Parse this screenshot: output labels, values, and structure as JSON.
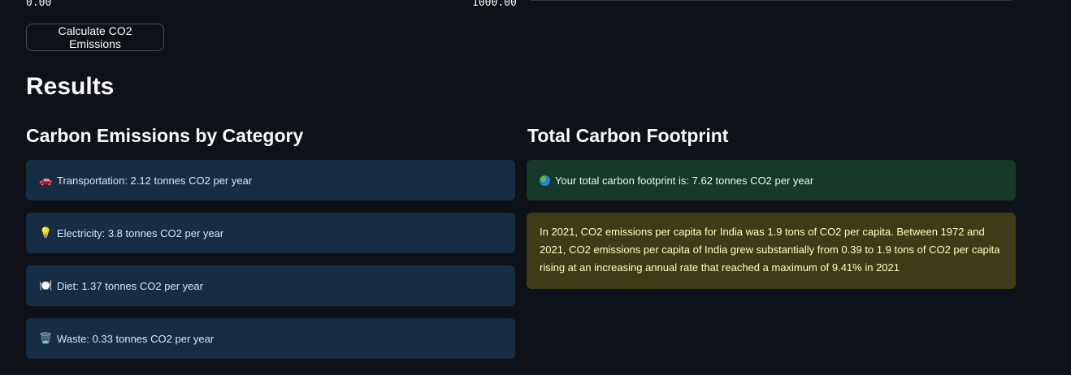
{
  "slider": {
    "min_label": "0.00",
    "max_label": "1000.00"
  },
  "calculate_button": {
    "label": "Calculate CO2 Emissions"
  },
  "results": {
    "title": "Results"
  },
  "categories": {
    "heading": "Carbon Emissions by Category",
    "items": [
      {
        "icon": "car-icon",
        "glyph": "🚗",
        "text": "Transportation: 2.12 tonnes CO2 per year"
      },
      {
        "icon": "lightbulb-icon",
        "glyph": "💡",
        "text": "Electricity: 3.8 tonnes CO2 per year"
      },
      {
        "icon": "plate-icon",
        "glyph": "🍽️",
        "text": "Diet: 1.37 tonnes CO2 per year"
      },
      {
        "icon": "wastebasket-icon",
        "glyph": "🗑️",
        "text": "Waste: 0.33 tonnes CO2 per year"
      }
    ]
  },
  "total": {
    "heading": "Total Carbon Footprint",
    "icon": "globe-icon",
    "text": "Your total carbon footprint is: 7.62 tonnes CO2 per year",
    "info_text": "In 2021, CO2 emissions per capita for India was 1.9 tons of CO2 per capita. Between 1972 and 2021, CO2 emissions per capita of India grew substantially from 0.39 to 1.9 tons of CO2 per capita rising at an increasing annual rate that reached a maximum of 9.41% in 2021"
  },
  "colors": {
    "background": "#0e1117",
    "info_bg": "#172d43",
    "success_bg": "#173928",
    "warning_bg": "#3e3b16"
  }
}
